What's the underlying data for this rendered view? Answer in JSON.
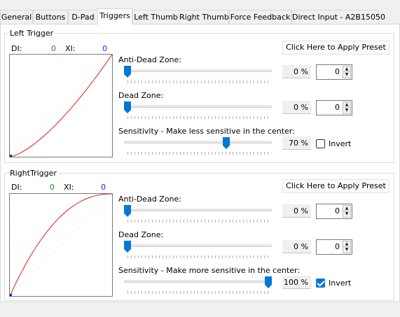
{
  "tabs": [
    {
      "label": "General"
    },
    {
      "label": "Buttons"
    },
    {
      "label": "D-Pad"
    },
    {
      "label": "Triggers"
    },
    {
      "label": "Left Thumb"
    },
    {
      "label": "Right Thumb"
    },
    {
      "label": "Force Feedback"
    },
    {
      "label": "Direct Input - A2B15050"
    }
  ],
  "active_tab": "Triggers",
  "left": {
    "title": "Left Trigger",
    "di_label": "DI:",
    "di_value": "0",
    "xi_label": "XI:",
    "xi_value": "0",
    "preset_button": "Click Here to Apply Preset",
    "anti_dead_zone_label": "Anti-Dead Zone:",
    "anti_dead_zone_pct": "0 %",
    "anti_dead_zone_spin": "0",
    "anti_dead_zone_level": 0,
    "dead_zone_label": "Dead Zone:",
    "dead_zone_pct": "0 %",
    "dead_zone_spin": "0",
    "dead_zone_level": 0,
    "sensitivity_label": "Sensitivity - Make less sensitive in the center:",
    "sensitivity_pct": "70 %",
    "sensitivity_level": 0.7,
    "invert_label": "Invert",
    "invert_checked": false,
    "curve": "less"
  },
  "right": {
    "title": "RightTrigger",
    "di_label": "DI:",
    "di_value": "0",
    "xi_label": "XI:",
    "xi_value": "0",
    "preset_button": "Click Here to Apply Preset",
    "anti_dead_zone_label": "Anti-Dead Zone:",
    "anti_dead_zone_pct": "0 %",
    "anti_dead_zone_spin": "0",
    "anti_dead_zone_level": 0,
    "dead_zone_label": "Dead Zone:",
    "dead_zone_pct": "0 %",
    "dead_zone_spin": "0",
    "dead_zone_level": 0,
    "sensitivity_label": "Sensitivity - Make more sensitive in the center:",
    "sensitivity_pct": "100 %",
    "sensitivity_level": 1.0,
    "invert_label": "Invert",
    "invert_checked": true,
    "curve": "more"
  },
  "colors": {
    "accent": "#0078d7",
    "di_value": "#1e8c1e",
    "xi_value": "#1e1edc",
    "curve": "#d42020"
  }
}
